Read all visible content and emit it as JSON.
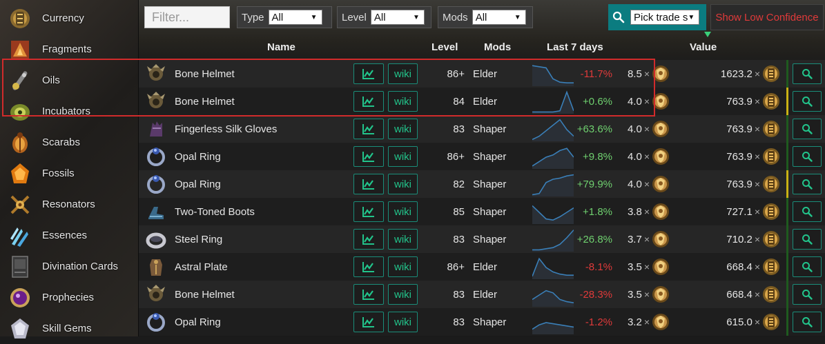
{
  "sidebar": {
    "items": [
      {
        "label": "Currency",
        "icon": "currency-icon"
      },
      {
        "label": "Fragments",
        "icon": "fragments-icon"
      },
      {
        "label": "Oils",
        "icon": "oils-icon"
      },
      {
        "label": "Incubators",
        "icon": "incubators-icon"
      },
      {
        "label": "Scarabs",
        "icon": "scarabs-icon"
      },
      {
        "label": "Fossils",
        "icon": "fossils-icon"
      },
      {
        "label": "Resonators",
        "icon": "resonators-icon"
      },
      {
        "label": "Essences",
        "icon": "essences-icon"
      },
      {
        "label": "Divination Cards",
        "icon": "divination-cards-icon"
      },
      {
        "label": "Prophecies",
        "icon": "prophecies-icon"
      },
      {
        "label": "Skill Gems",
        "icon": "skill-gems-icon"
      }
    ]
  },
  "toolbar": {
    "filter_placeholder": "Filter...",
    "type_label": "Type",
    "type_value": "All",
    "level_label": "Level",
    "level_value": "All",
    "mods_label": "Mods",
    "mods_value": "All",
    "trade_value": "Pick trade s",
    "low_confidence_label": "Show Low Confidence"
  },
  "table": {
    "headers": {
      "name": "Name",
      "level": "Level",
      "mods": "Mods",
      "last7": "Last 7 days",
      "value": "Value"
    },
    "wiki_label": "wiki",
    "rows": [
      {
        "name": "Bone Helmet",
        "level": "86+",
        "mods": "Elder",
        "change": "-11.7%",
        "ex": "8.5",
        "chaos": "1623.2",
        "spark": [
          0.9,
          0.85,
          0.8,
          0.3,
          0.15,
          0.12,
          0.12
        ],
        "bar": ""
      },
      {
        "name": "Bone Helmet",
        "level": "84",
        "mods": "Elder",
        "change": "+0.6%",
        "ex": "4.0",
        "chaos": "763.9",
        "spark": [
          0.05,
          0.05,
          0.05,
          0.05,
          0.1,
          0.95,
          0.1
        ],
        "bar": "#c9b214"
      },
      {
        "name": "Fingerless Silk Gloves",
        "level": "83",
        "mods": "Shaper",
        "change": "+63.6%",
        "ex": "4.0",
        "chaos": "763.9",
        "spark": [
          0.05,
          0.2,
          0.45,
          0.7,
          0.95,
          0.5,
          0.2
        ],
        "bar": ""
      },
      {
        "name": "Opal Ring",
        "level": "86+",
        "mods": "Shaper",
        "change": "+9.8%",
        "ex": "4.0",
        "chaos": "763.9",
        "spark": [
          0.1,
          0.3,
          0.5,
          0.6,
          0.8,
          0.9,
          0.5
        ],
        "bar": ""
      },
      {
        "name": "Opal Ring",
        "level": "82",
        "mods": "Shaper",
        "change": "+79.9%",
        "ex": "4.0",
        "chaos": "763.9",
        "spark": [
          0.05,
          0.1,
          0.6,
          0.75,
          0.8,
          0.9,
          0.95
        ],
        "bar": "#c9b214"
      },
      {
        "name": "Two-Toned Boots",
        "level": "85",
        "mods": "Shaper",
        "change": "+1.8%",
        "ex": "3.8",
        "chaos": "727.1",
        "spark": [
          0.8,
          0.5,
          0.2,
          0.15,
          0.3,
          0.5,
          0.7
        ],
        "bar": ""
      },
      {
        "name": "Steel Ring",
        "level": "83",
        "mods": "Shaper",
        "change": "+26.8%",
        "ex": "3.7",
        "chaos": "710.2",
        "spark": [
          0.05,
          0.05,
          0.1,
          0.15,
          0.3,
          0.6,
          0.95
        ],
        "bar": ""
      },
      {
        "name": "Astral Plate",
        "level": "86+",
        "mods": "Elder",
        "change": "-8.1%",
        "ex": "3.5",
        "chaos": "668.4",
        "spark": [
          0.1,
          0.9,
          0.5,
          0.3,
          0.2,
          0.15,
          0.15
        ],
        "bar": ""
      },
      {
        "name": "Bone Helmet",
        "level": "83",
        "mods": "Elder",
        "change": "-28.3%",
        "ex": "3.5",
        "chaos": "668.4",
        "spark": [
          0.3,
          0.5,
          0.7,
          0.6,
          0.3,
          0.2,
          0.15
        ],
        "bar": ""
      },
      {
        "name": "Opal Ring",
        "level": "83",
        "mods": "Shaper",
        "change": "-1.2%",
        "ex": "3.2",
        "chaos": "615.0",
        "spark": [
          0.2,
          0.4,
          0.5,
          0.45,
          0.4,
          0.35,
          0.3
        ],
        "bar": ""
      }
    ]
  },
  "colors": {
    "positive": "#6fd06f",
    "negative": "#e03a3a",
    "accent": "#22c48b",
    "trade_bg": "#0b7c80",
    "sparkline": "#3a7fb8",
    "green_bar": "#1f5a1f"
  }
}
